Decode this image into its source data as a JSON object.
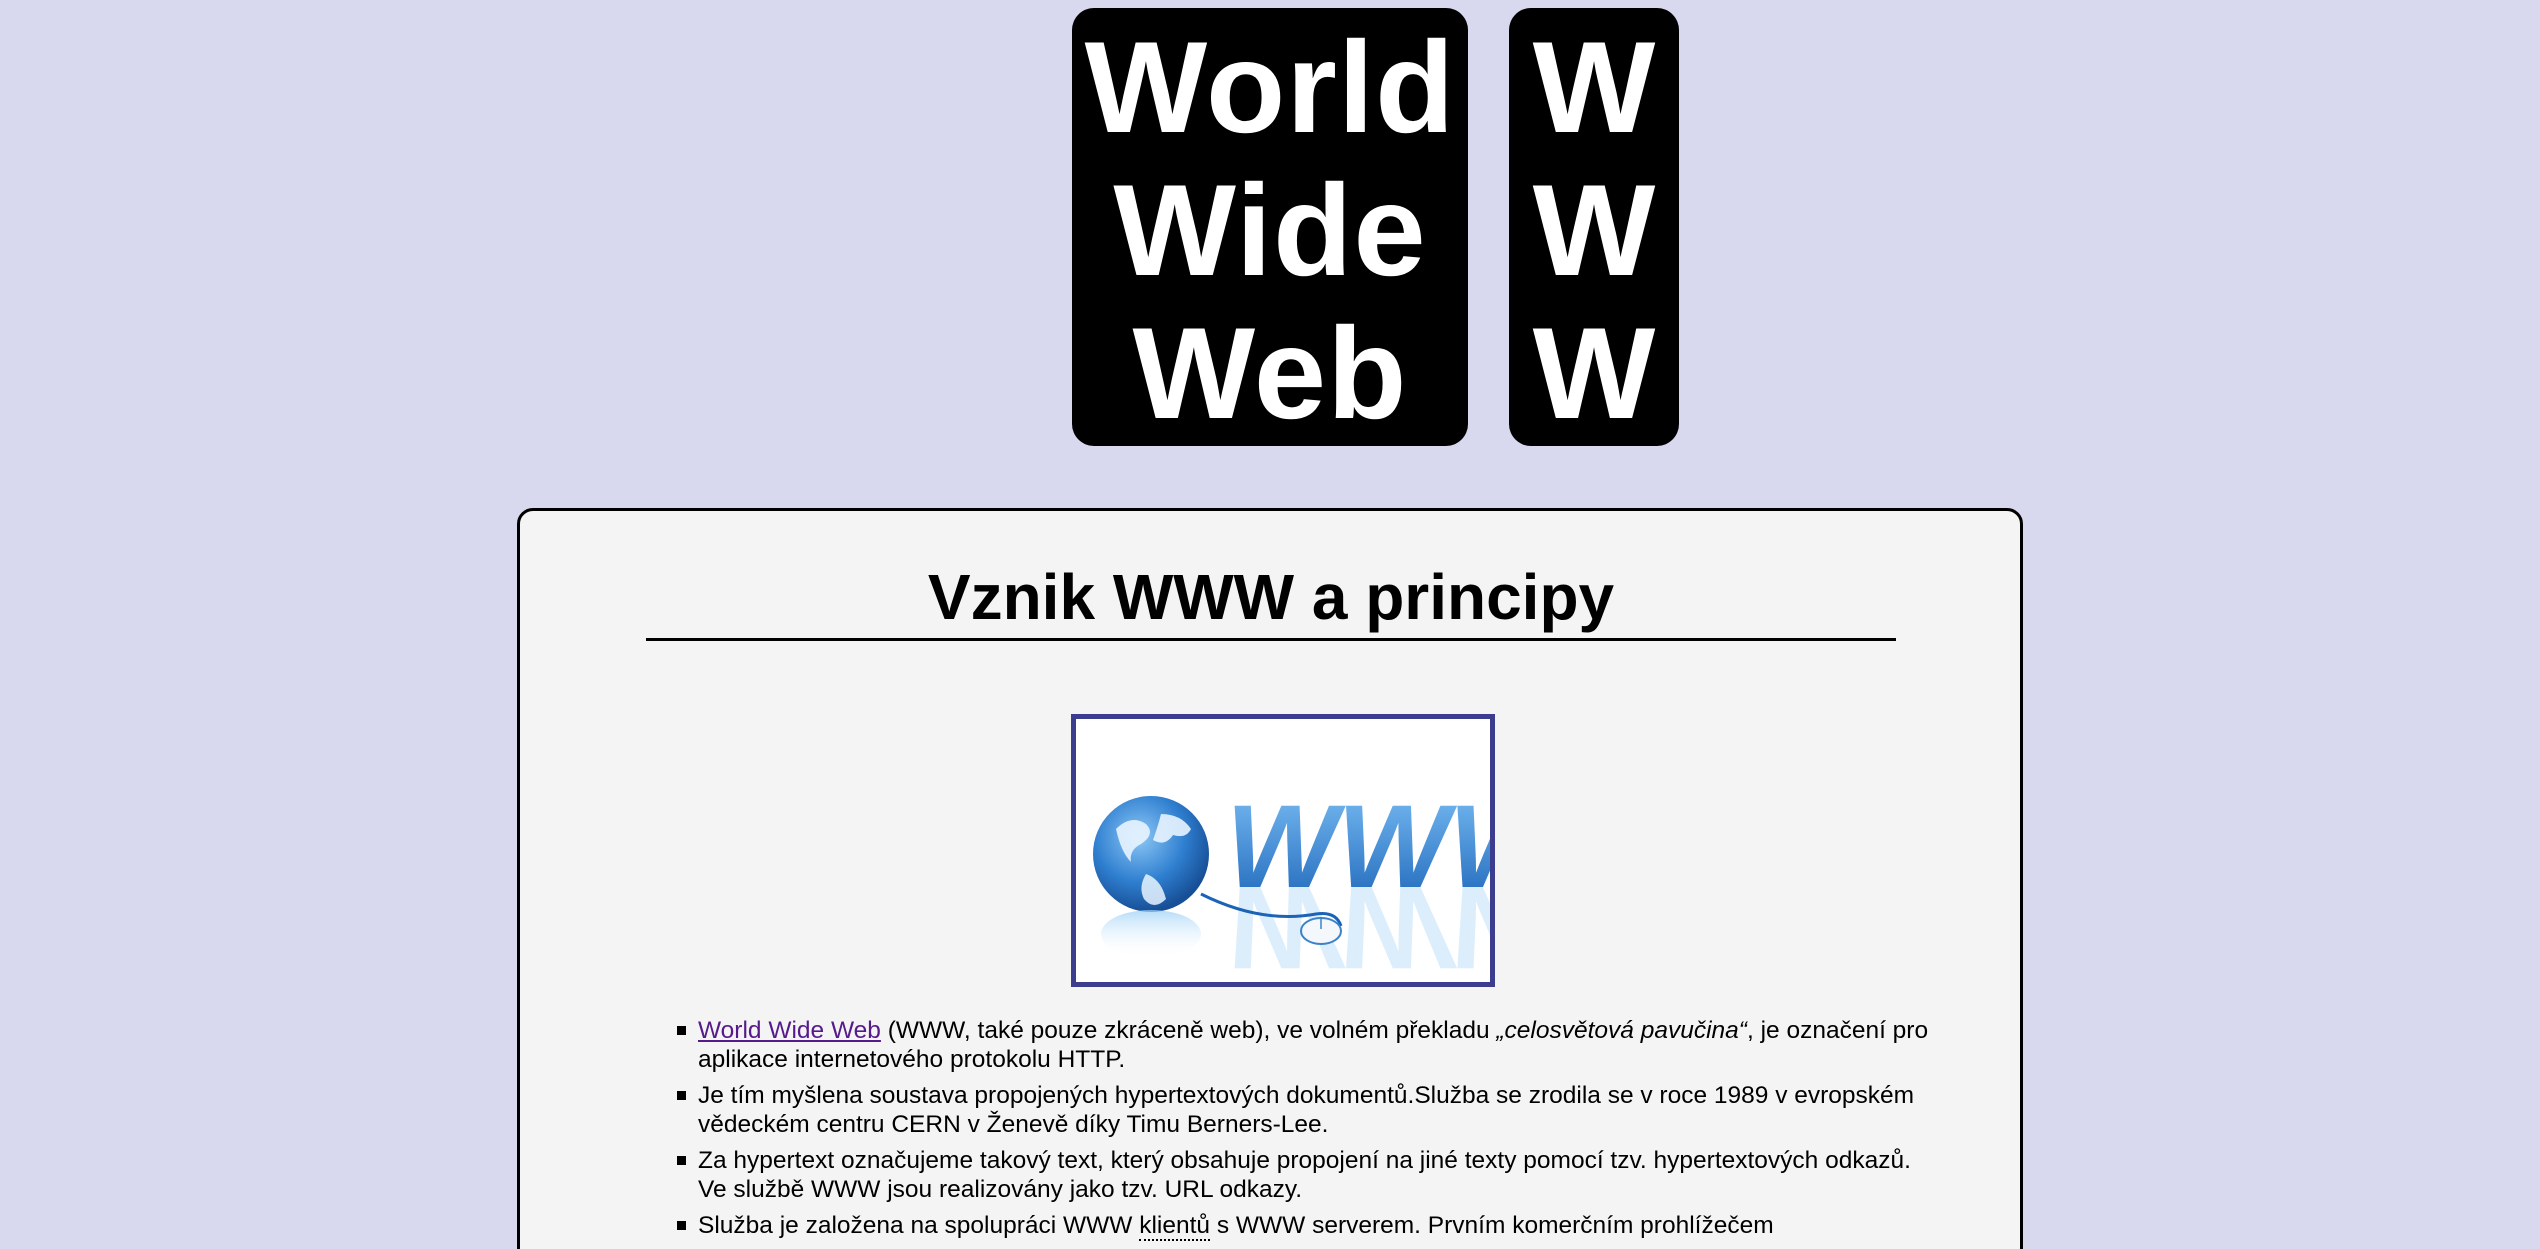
{
  "header": {
    "logo_main": [
      "World",
      "Wide",
      "Web"
    ],
    "logo_short": [
      "W",
      "W",
      "W"
    ]
  },
  "main": {
    "title": "Vznik WWW a principy",
    "hero_image_label": "WWW",
    "bullets": [
      {
        "link_text": "World Wide Web",
        "text_after_link": " (WWW, také pouze zkráceně web), ve volném překladu ",
        "italic": "„celosvětová pavučina“",
        "text_end": ", je označení pro aplikace internetového protokolu HTTP."
      },
      {
        "text": "Je tím myšlena soustava propojených hypertextových dokumentů.Služba se zrodila se v roce 1989 v evropském vědeckém centru CERN v Ženevě díky Timu Berners-Lee."
      },
      {
        "text": "Za hypertext označujeme takový text, který obsahuje propojení na jiné texty pomocí tzv. hypertextových odkazů. Ve službě WWW jsou realizovány jako tzv. URL odkazy."
      },
      {
        "text_before": "Služba je založena na spolupráci WWW ",
        "abbr": "klientů",
        "text_after": " s WWW serverem. Prvním komerčním prohlížečem"
      }
    ]
  },
  "colors": {
    "page_background": "#d8d8ee",
    "card_background": "#f4f4f4",
    "logo_background": "#000000",
    "logo_text": "#ffffff",
    "image_border": "#3d3d8f",
    "link": "#551a8b"
  }
}
